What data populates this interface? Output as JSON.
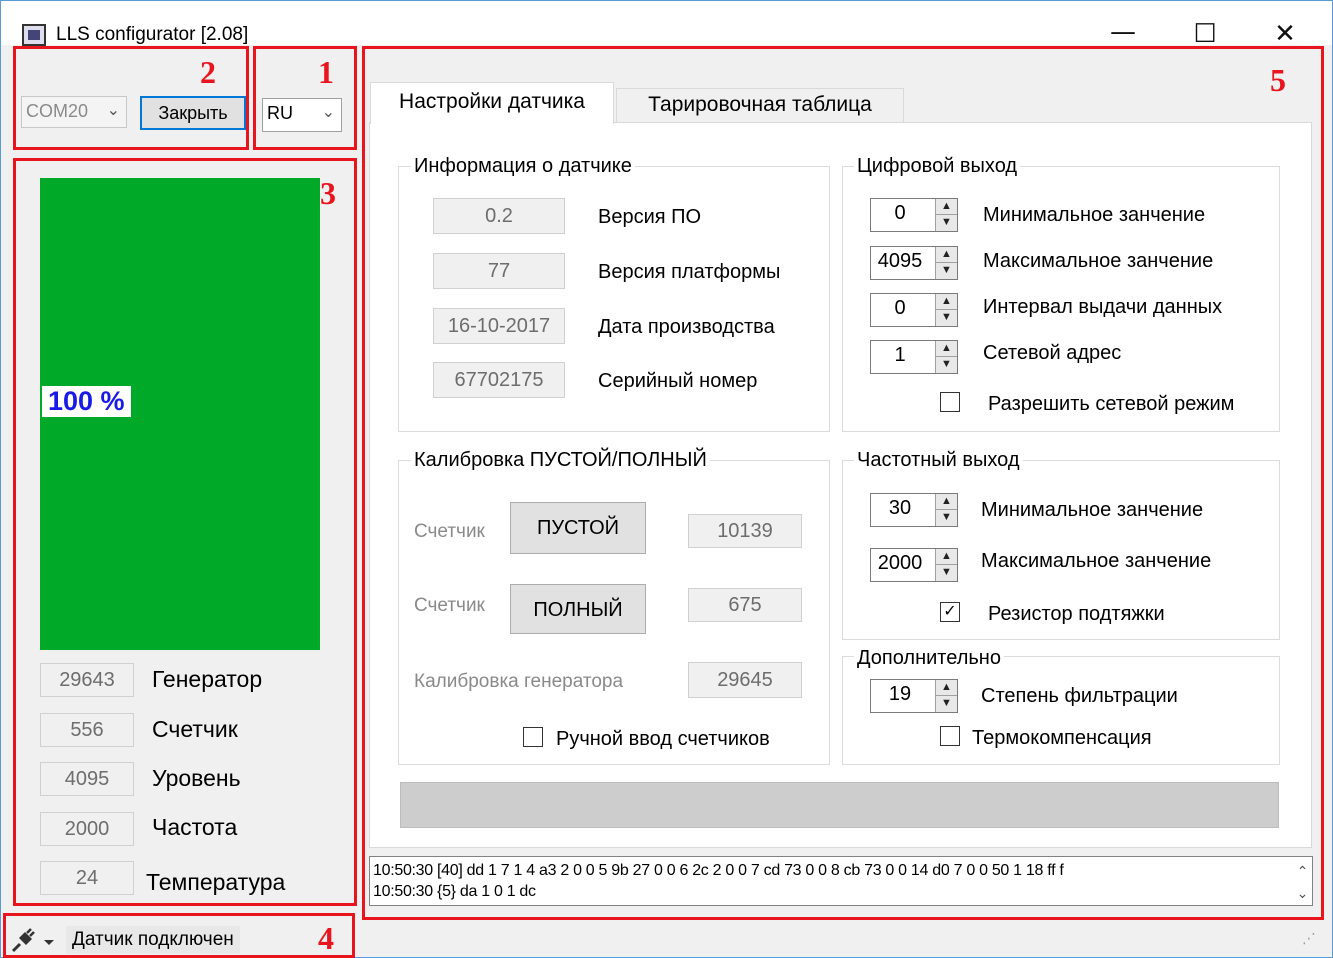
{
  "window": {
    "title": "LLS configurator [2.08]",
    "minimize_glyph": "—",
    "maximize_glyph": "☐",
    "close_glyph": "✕"
  },
  "annotations": [
    "1",
    "2",
    "3",
    "4",
    "5"
  ],
  "connection": {
    "port_value": "COM20",
    "close_button": "Закрыть",
    "language_value": "RU"
  },
  "level": {
    "percent_label": "100 %",
    "fill_fraction": 1.0,
    "fill_color": "#00aa28",
    "readouts": [
      {
        "value": "29643",
        "label": "Генератор"
      },
      {
        "value": "556",
        "label": "Счетчик"
      },
      {
        "value": "4095",
        "label": "Уровень"
      },
      {
        "value": "2000",
        "label": "Частота"
      },
      {
        "value": "24",
        "label": "Температура"
      }
    ]
  },
  "tabs": [
    {
      "label": "Настройки датчика",
      "active": true
    },
    {
      "label": "Тарировочная таблица",
      "active": false
    }
  ],
  "sensor_info": {
    "title": "Информация о датчике",
    "rows": [
      {
        "value": "0.2",
        "label": "Версия ПО"
      },
      {
        "value": "77",
        "label": "Версия платформы"
      },
      {
        "value": "16-10-2017",
        "label": "Дата производства"
      },
      {
        "value": "67702175",
        "label": "Серийный номер"
      }
    ]
  },
  "digital_output": {
    "title": "Цифровой выход",
    "rows": [
      {
        "value": "0",
        "label": "Минимальное занчение"
      },
      {
        "value": "4095",
        "label": "Максимальное занчение"
      },
      {
        "value": "0",
        "label": "Интервал выдачи данных"
      },
      {
        "value": "1",
        "label": "Сетевой адрес"
      }
    ],
    "network_mode_label": "Разрешить сетевой режим",
    "network_mode_checked": false
  },
  "calibration": {
    "title": "Калибровка ПУСТОЙ/ПОЛНЫЙ",
    "counter_label": "Счетчик",
    "empty_button": "ПУСТОЙ",
    "empty_value": "10139",
    "full_button": "ПОЛНЫЙ",
    "full_value": "675",
    "generator_label": "Калибровка генератора",
    "generator_value": "29645",
    "manual_label": "Ручной ввод счетчиков",
    "manual_checked": false
  },
  "frequency_output": {
    "title": "Частотный выход",
    "rows": [
      {
        "value": "30",
        "label": "Минимальное занчение"
      },
      {
        "value": "2000",
        "label": "Максимальное занчение"
      }
    ],
    "pullup_label": "Резистор подтяжки",
    "pullup_checked": true
  },
  "additional": {
    "title": "Дополнительно",
    "filter_value": "19",
    "filter_label": "Степень фильтрации",
    "thermo_label": "Термокомпенсация",
    "thermo_checked": false
  },
  "log": {
    "lines": [
      "10:50:30 [40]  dd 1 7 1 4 a3 2 0 0 5 9b 27 0 0 6 2c 2 0 0 7 cd 73 0 0 8 cb 73 0 0 14 d0 7 0 0 50 1 18 ff f",
      "10:50:30 {5}  da 1 0 1 dc"
    ]
  },
  "status": {
    "text": "Датчик подключен",
    "icon": "plug-icon"
  },
  "accent_red": "#e8141e"
}
